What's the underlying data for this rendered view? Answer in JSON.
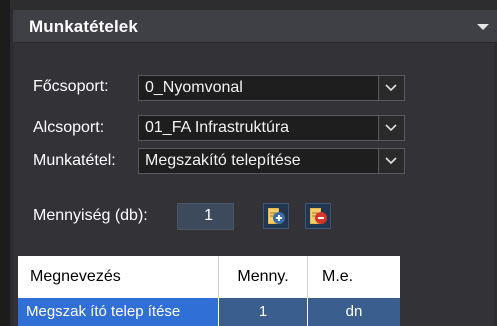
{
  "panel": {
    "title": "Munkatételek"
  },
  "fields": {
    "focsoport": {
      "label": "Főcsoport:",
      "value": "0_Nyomvonal"
    },
    "alcsoport": {
      "label": "Alcsoport:",
      "value": "01_FA Infrastruktúra"
    },
    "munkatetel": {
      "label": "Munkatétel:",
      "value": "Megszakító telepítése"
    }
  },
  "quantity": {
    "label": "Mennyiség (db):",
    "value": "1"
  },
  "buttons": {
    "add": "add-item",
    "remove": "remove-item"
  },
  "table": {
    "headers": [
      "Megnevezés",
      "Menny.",
      "M.e."
    ],
    "rows": [
      [
        "Megszak ító telep ítése",
        "1",
        "dn"
      ]
    ]
  },
  "colors": {
    "selection": "#2f6fd6",
    "accent": "#3b6ea5",
    "remove": "#d9342b"
  }
}
